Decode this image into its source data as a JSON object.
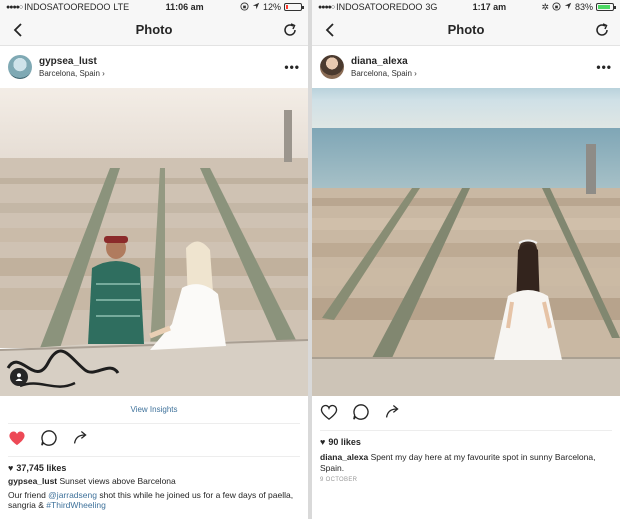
{
  "left": {
    "status": {
      "carrier": "INDOSATOOREDOO",
      "network": "LTE",
      "time": "11:06 am",
      "battery": "12%",
      "battery_color": "#ff3b30"
    },
    "nav": {
      "title": "Photo"
    },
    "post": {
      "username": "gypsea_lust",
      "location": "Barcelona, Spain",
      "view_insights": "View Insights",
      "likes": "37,745 likes",
      "caption_user": "gypsea_lust",
      "caption_text": "Sunset views above Barcelona",
      "comment_text_1": "Our friend",
      "comment_mention": "@jarradseng",
      "comment_text_2": "shot this while he joined us for a few days of paella, sangria &",
      "comment_hashtag": "#ThirdWheeling"
    },
    "icons": [
      "back-icon",
      "refresh-icon",
      "more-icon",
      "heart-filled-icon",
      "comment-icon",
      "share-icon",
      "tag-people-icon"
    ]
  },
  "right": {
    "status": {
      "carrier": "INDOSATOOREDOO",
      "network": "3G",
      "time": "1:17 am",
      "battery": "83%",
      "battery_color": "#4cd964"
    },
    "nav": {
      "title": "Photo"
    },
    "post": {
      "username": "diana_alexa",
      "location": "Barcelona, Spain",
      "likes": "90 likes",
      "caption_user": "diana_alexa",
      "caption_text": "Spent my day here at my favourite spot in sunny Barcelona, Spain.",
      "date": "9 OCTOBER"
    },
    "icons": [
      "back-icon",
      "refresh-icon",
      "more-icon",
      "heart-outline-icon",
      "comment-icon",
      "share-icon"
    ]
  },
  "colors": {
    "like_red": "#ed4956",
    "link_blue": "#3f729b"
  }
}
